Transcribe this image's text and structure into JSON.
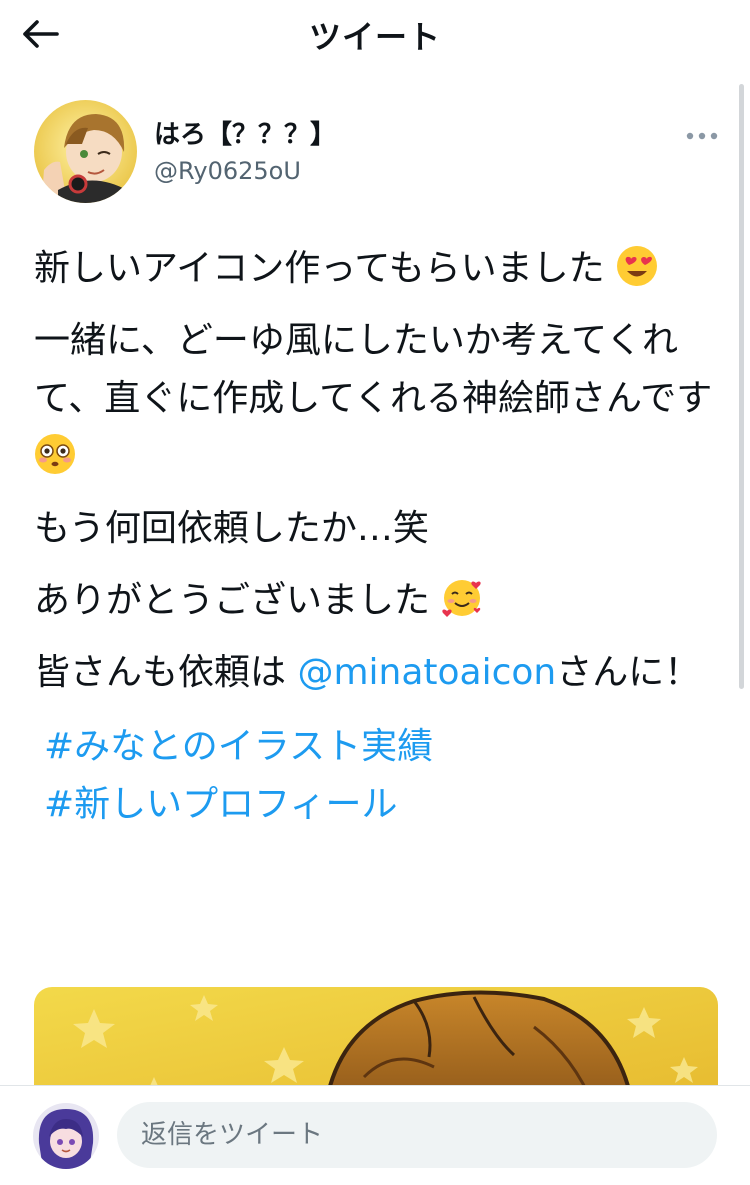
{
  "header": {
    "title": "ツイート"
  },
  "tweet": {
    "author": {
      "display_name": "はろ【？？？】",
      "handle": "@Ry0625oU"
    },
    "paragraphs": {
      "p1": "新しいアイコン作ってもらいました",
      "p2": "一緒に、どーゆ風にしたいか考えてくれて、直ぐに作成してくれる神絵師さんです",
      "p3": "もう何回依頼したか…笑",
      "p4": "ありがとうございました",
      "p5_before": "皆さんも依頼は ",
      "p5_mention": "@minatoaicon",
      "p5_after": "さんに！"
    },
    "hashtags": [
      "#みなとのイラスト実績",
      "#新しいプロフィール"
    ],
    "emojis": [
      "heart-eyes-emoji",
      "flushed-emoji",
      "smiling-face-with-hearts-emoji"
    ]
  },
  "reply": {
    "placeholder": "返信をツイート"
  },
  "colors": {
    "link": "#1d9bf0",
    "text": "#0f1419",
    "secondary": "#536471",
    "input_bg": "#eff3f4"
  }
}
